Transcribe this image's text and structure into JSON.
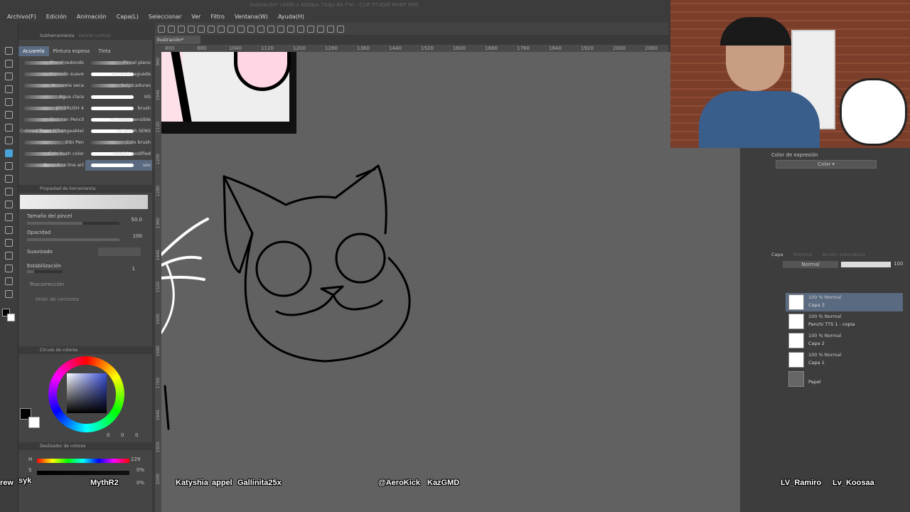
{
  "window": {
    "title": "Ilustración* (4000 x 4000px 72dpi 80.7%) - CLIP STUDIO PAINT PRO"
  },
  "menu": [
    "Archivo(F)",
    "Edición",
    "Animación",
    "Capa(L)",
    "Seleccionar",
    "Ver",
    "Filtro",
    "Ventana(W)",
    "Ayuda(H)"
  ],
  "canvas_tab": "Ilustración*",
  "ruler_ticks": [
    "800",
    "880",
    "1040",
    "1120",
    "1200",
    "1280",
    "1360",
    "1440",
    "1520",
    "1600",
    "1680",
    "1760",
    "1840",
    "1920",
    "2000",
    "2080"
  ],
  "ruler_left_ticks": [
    "960",
    "1040",
    "1120",
    "1200",
    "1280",
    "1360",
    "1440",
    "1520",
    "1600",
    "1680",
    "1760",
    "1840",
    "1920",
    "2000"
  ],
  "subtool": {
    "title": "Subherramienta",
    "title2": "Detalle subtool",
    "tabs": [
      "Acuarela",
      "Pintura espesa",
      "Tinta"
    ],
    "brushes_left": [
      "Pincel redondo",
      "Húmedo suave",
      "Acuarela seca",
      "Agua clara",
      "JEKBRUSH 4",
      "Suzuran Pencil",
      "Colored Trees (Changeable)",
      "Bibi Pen",
      "Colo bush color",
      "Sunsubus line art"
    ],
    "brushes_right": [
      "Pincel plano",
      "Acuarela aguada",
      "Salpicaduras",
      "VG",
      "brush",
      "mi brush sensible",
      "mi brush SENS",
      "Colo brush",
      "HIMOG modified",
      "sex"
    ]
  },
  "tool_property": {
    "title": "Propiedad de herramienta",
    "brush_size_label": "Tamaño del pincel",
    "brush_size_value": "50.0",
    "opacity_label": "Opacidad",
    "opacity_value": "100",
    "smoothing_label": "Suavizado",
    "stabilization_label": "Estabilización",
    "stabilization_value": "1",
    "post_correction_label": "Poscorrección",
    "vector_magnet_label": "Imán de vectores"
  },
  "color_circle": {
    "title": "Círculo de colores",
    "values": [
      "0",
      "0",
      "0"
    ]
  },
  "color_slider": {
    "title": "Deslizador de colores",
    "h_label": "H",
    "h_value": "229",
    "s_label": "S",
    "s_value": "0%",
    "v_label": "V",
    "v_value": "0%"
  },
  "expression_color": {
    "title": "Color de expresión",
    "value": "Color"
  },
  "layers_panel": {
    "tabs": [
      "Capa",
      "Historial",
      "Acción automática"
    ],
    "blend_mode": "Normal",
    "opacity": "100",
    "layers": [
      {
        "mode": "100 % Normal",
        "name": "Capa 3",
        "selected": true
      },
      {
        "mode": "100 % Normal",
        "name": "Panchi TTS 1 - copia",
        "selected": false
      },
      {
        "mode": "100 % Normal",
        "name": "Capa 2",
        "selected": false
      },
      {
        "mode": "100 % Normal",
        "name": "Capa 1",
        "selected": false
      },
      {
        "mode": "",
        "name": "Papel",
        "selected": false
      }
    ]
  },
  "stream_overlay": {
    "names": [
      "Katyshia",
      "appel",
      "Gallinita25x",
      "@AeroKick",
      "KazGMD",
      "LV_Ramiro",
      "Lv_Koosaa",
      "MythR2",
      "rew",
      "syk"
    ]
  },
  "colors": {
    "canvas_bg": "#616161",
    "panel_bg": "#454545",
    "selected": "#5a6a80",
    "accent_hue": "#3a4fd8"
  }
}
